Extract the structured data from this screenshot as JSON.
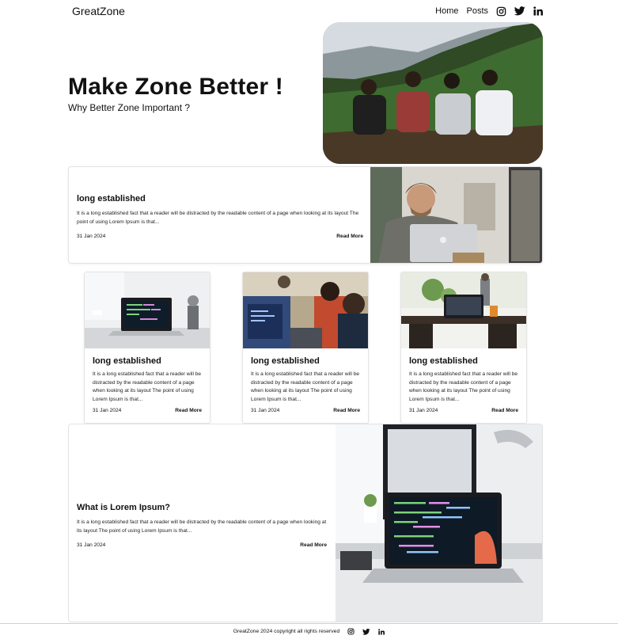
{
  "nav": {
    "brand": "GreatZone",
    "links": [
      "Home",
      "Posts"
    ],
    "icons": [
      "instagram-icon",
      "twitter-icon",
      "linkedin-icon"
    ]
  },
  "hero": {
    "title": "Make Zone Better !",
    "subtitle": "Why Better Zone Important ?"
  },
  "featured": {
    "title": "long established",
    "description": "It is a long established fact that a reader will be distracted by the readable content of a page when looking at its layout The point of using Lorem Ipsum is that...",
    "date": "31 Jan 2024",
    "read_more": "Read More"
  },
  "cards": [
    {
      "title": "long established",
      "description": "It is a long established fact that a reader will be distracted by the readable content of a page when looking at its layout The point of using Lorem Ipsum is that...",
      "date": "31 Jan 2024",
      "read_more": "Read More"
    },
    {
      "title": "long established",
      "description": "It is a long established fact that a reader will be distracted by the readable content of a page when looking at its layout The point of using Lorem Ipsum is that...",
      "date": "31 Jan 2024",
      "read_more": "Read More"
    },
    {
      "title": "long established",
      "description": "It is a long established fact that a reader will be distracted by the readable content of a page when looking at its layout The point of using Lorem Ipsum is that...",
      "date": "31 Jan 2024",
      "read_more": "Read More"
    }
  ],
  "bottom_post": {
    "title": "What is Lorem Ipsum?",
    "description": "It is a long established fact that a reader will be distracted by the readable content of a page when looking at its layout The point of using Lorem Ipsum is that...",
    "date": "31 Jan 2024",
    "read_more": "Read More"
  },
  "footer": {
    "copyright": "GreatZone 2024 copyright all rights reserved"
  }
}
